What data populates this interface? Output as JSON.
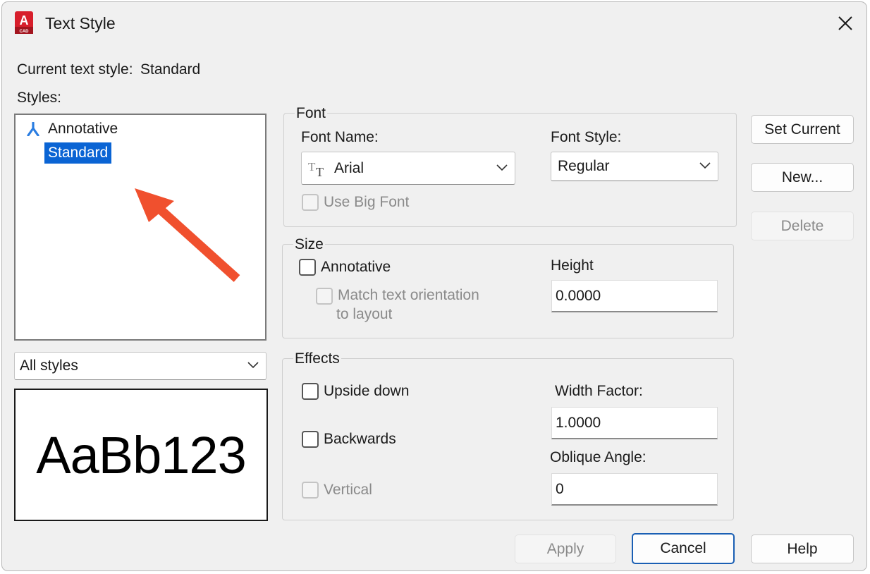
{
  "window": {
    "title": "Text Style",
    "app_icon": "autocad-icon",
    "app_icon_letter": "A",
    "app_icon_sub": "CAD",
    "close_icon": "close-icon"
  },
  "current_style": {
    "label": "Current text style:",
    "value": "Standard"
  },
  "styles": {
    "label": "Styles:",
    "items": [
      {
        "label": "Annotative",
        "icon": "annotative-icon",
        "selected": false
      },
      {
        "label": "Standard",
        "selected": true
      }
    ],
    "filter": {
      "value": "All styles"
    }
  },
  "preview": {
    "text": "AaBb123"
  },
  "font": {
    "group_label": "Font",
    "name_label": "Font Name:",
    "name_value": "Arial",
    "name_icon": "truetype-font-icon",
    "style_label": "Font Style:",
    "style_value": "Regular",
    "big_font_label": "Use Big Font",
    "big_font_checked": false
  },
  "size": {
    "group_label": "Size",
    "annotative_label": "Annotative",
    "annotative_checked": false,
    "match_label_line1": "Match text orientation",
    "match_label_line2": "to layout",
    "match_checked": false,
    "height_label": "Height",
    "height_value": "0.0000"
  },
  "effects": {
    "group_label": "Effects",
    "upside_down_label": "Upside down",
    "upside_down_checked": false,
    "backwards_label": "Backwards",
    "backwards_checked": false,
    "vertical_label": "Vertical",
    "vertical_checked": false,
    "width_factor_label": "Width Factor:",
    "width_factor_value": "1.0000",
    "oblique_label": "Oblique Angle:",
    "oblique_value": "0"
  },
  "buttons": {
    "set_current": "Set Current",
    "new": "New...",
    "delete": "Delete",
    "apply": "Apply",
    "cancel": "Cancel",
    "help": "Help"
  },
  "annotation": {
    "arrow_color": "#f0502e"
  },
  "colors": {
    "selection": "#0a64d4",
    "accent": "#1a5fb4"
  }
}
